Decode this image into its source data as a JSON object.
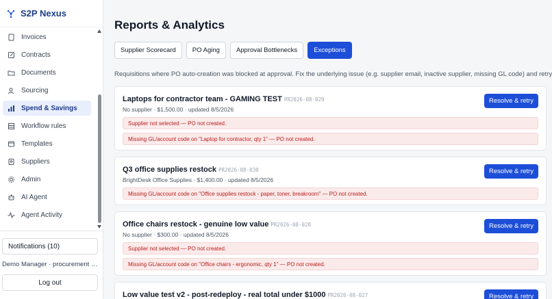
{
  "brand": {
    "name": "S2P Nexus"
  },
  "sidebar": {
    "items": [
      {
        "label": "Invoices",
        "icon": "file-icon",
        "active": false
      },
      {
        "label": "Contracts",
        "icon": "contract-icon",
        "active": false
      },
      {
        "label": "Documents",
        "icon": "folder-icon",
        "active": false
      },
      {
        "label": "Sourcing",
        "icon": "sourcing-icon",
        "active": false
      },
      {
        "label": "Spend & Savings",
        "icon": "bar-chart-icon",
        "active": true
      },
      {
        "label": "Workflow rules",
        "icon": "workflow-icon",
        "active": false
      },
      {
        "label": "Templates",
        "icon": "template-icon",
        "active": false
      },
      {
        "label": "Suppliers",
        "icon": "supplier-icon",
        "active": false
      },
      {
        "label": "Admin",
        "icon": "gear-icon",
        "active": false
      },
      {
        "label": "AI Agent",
        "icon": "robot-icon",
        "active": false
      },
      {
        "label": "Agent Activity",
        "icon": "activity-icon",
        "active": false
      }
    ],
    "notifications_label": "Notifications (10)",
    "user_label": "Demo Manager · procurement manager",
    "logout_label": "Log out"
  },
  "main": {
    "title": "Reports & Analytics",
    "tabs": [
      {
        "label": "Supplier Scorecard",
        "active": false
      },
      {
        "label": "PO Aging",
        "active": false
      },
      {
        "label": "Approval Bottlenecks",
        "active": false
      },
      {
        "label": "Exceptions",
        "active": true
      }
    ],
    "description": "Requisitions where PO auto-creation was blocked at approval. Fix the underlying issue (e.g. supplier email, inactive supplier, missing GL code) and retry.",
    "action_label": "Resolve & retry",
    "cards": [
      {
        "title": "Laptops for contractor team - GAMING TEST",
        "pr": "PR2026-08-029",
        "meta": "No supplier · $1,500.00 · updated 8/5/2026",
        "issues": [
          "Supplier not selected — PO not created.",
          "Missing GL/account code on \"Laptop for contractor, qty 1\" — PO not created."
        ]
      },
      {
        "title": "Q3 office supplies restock",
        "pr": "PR2026-08-030",
        "meta": "BrightDesk Office Supplies · $1,400.00 · updated 8/5/2026",
        "issues": [
          "Missing GL/account code on \"Office supplies restock - paper, toner, breakroom\" — PO not created."
        ]
      },
      {
        "title": "Office chairs restock - genuine low value",
        "pr": "PR2026-08-028",
        "meta": "No supplier · $300.00 · updated 8/5/2026",
        "issues": [
          "Supplier not selected — PO not created.",
          "Missing GL/account code on \"Office chairs - ergonomic, qty 1\" — PO not created."
        ]
      },
      {
        "title": "Low value test v2 - post-redeploy - real total under $1000",
        "pr": "PR2026-08-027",
        "meta": "",
        "issues": []
      }
    ]
  }
}
